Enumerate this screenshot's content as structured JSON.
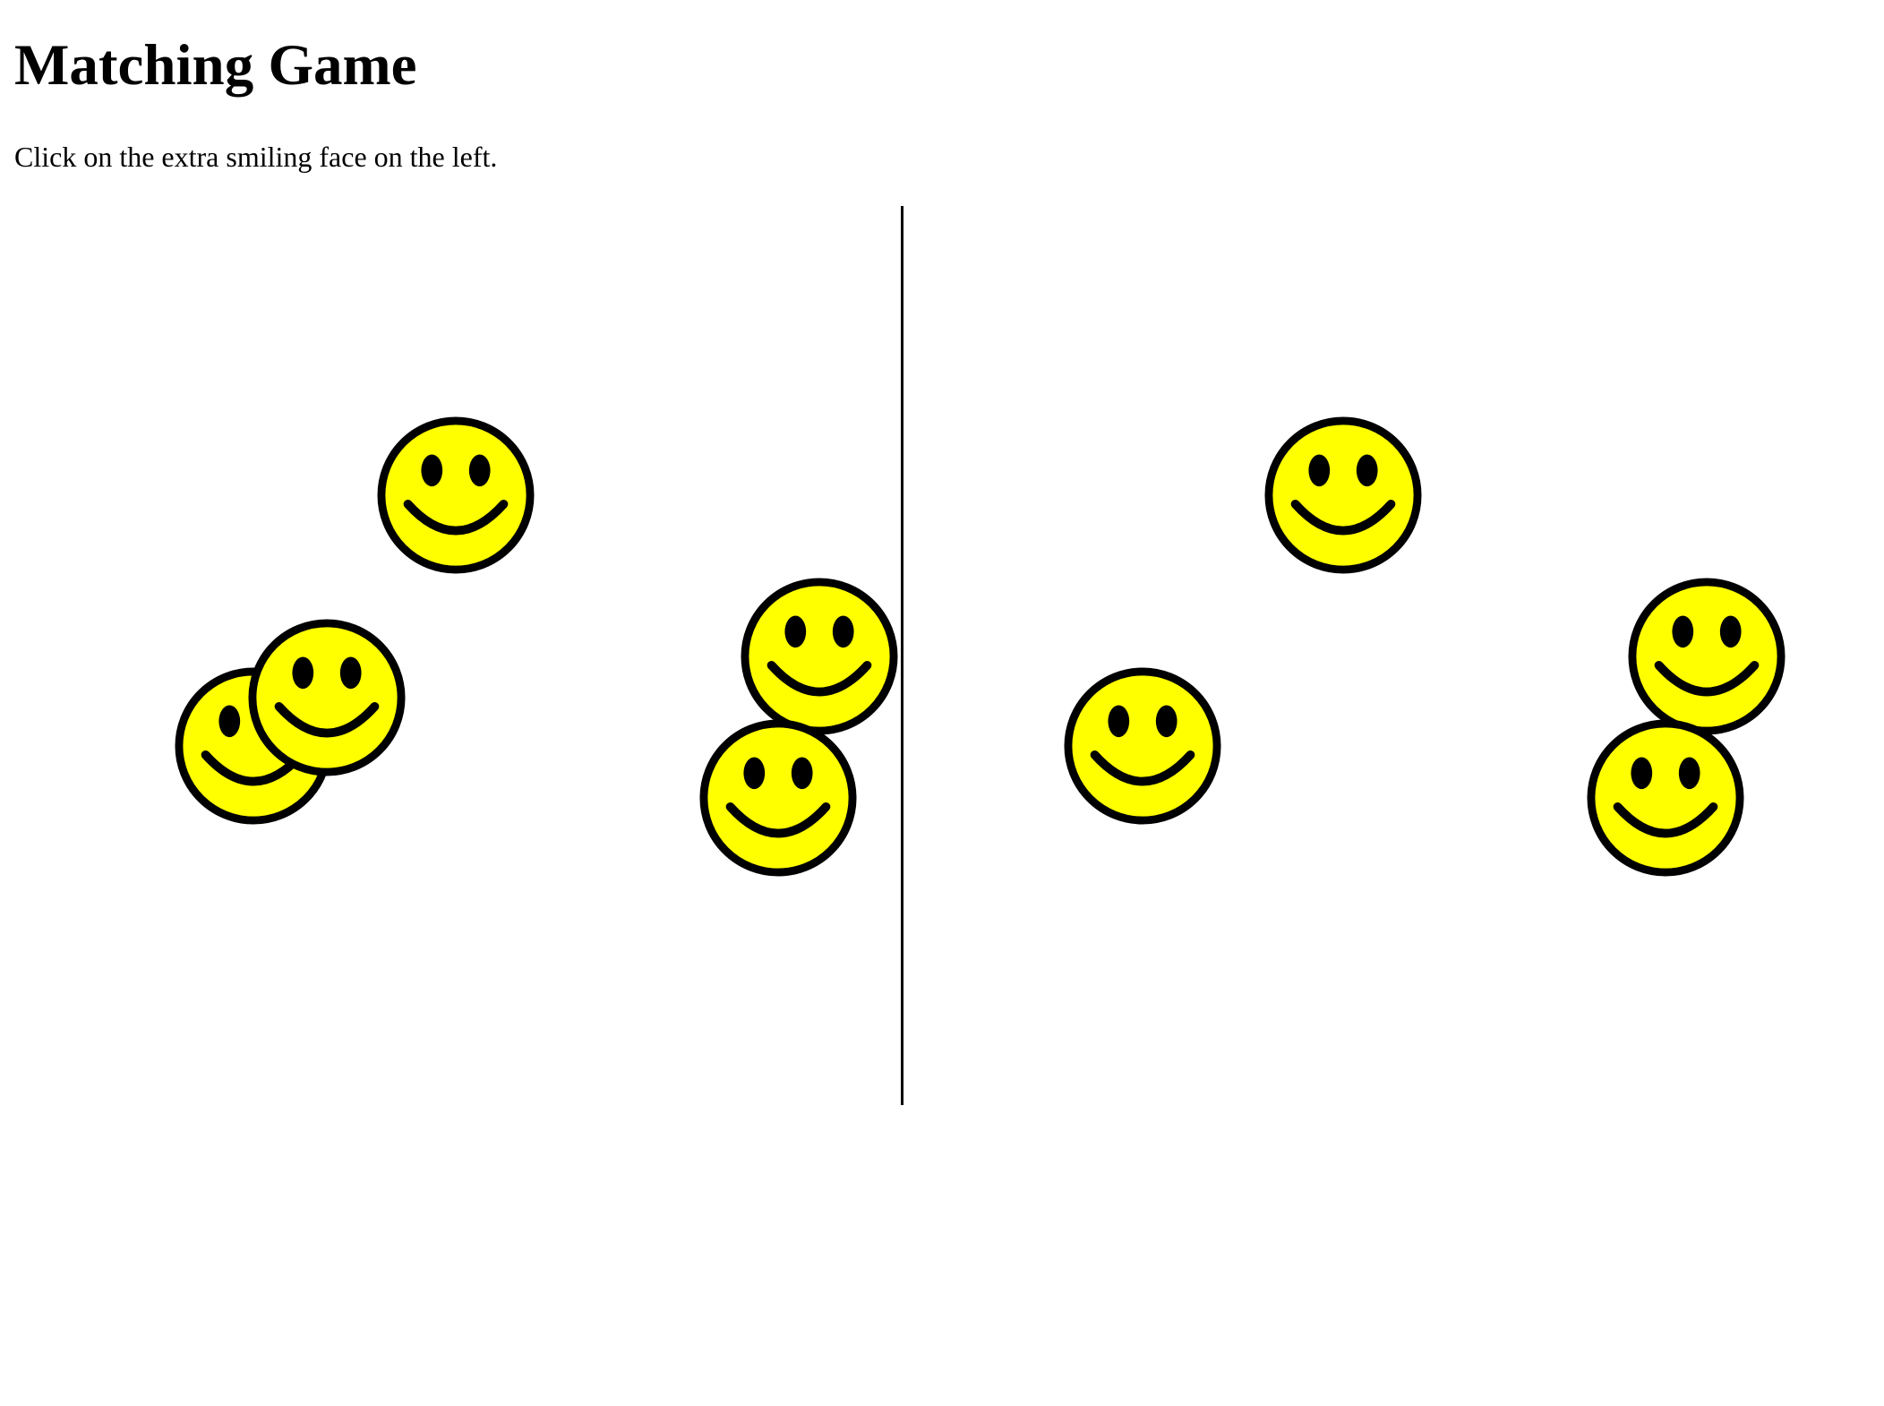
{
  "title": "Matching Game",
  "instructions": "Click on the extra smiling face on the left.",
  "face": {
    "icon": "smiley-face-icon",
    "fill_color": "#ffff00",
    "outline_color": "#000000"
  },
  "left_panel": {
    "face_count": 5
  },
  "right_panel": {
    "face_count": 4
  }
}
